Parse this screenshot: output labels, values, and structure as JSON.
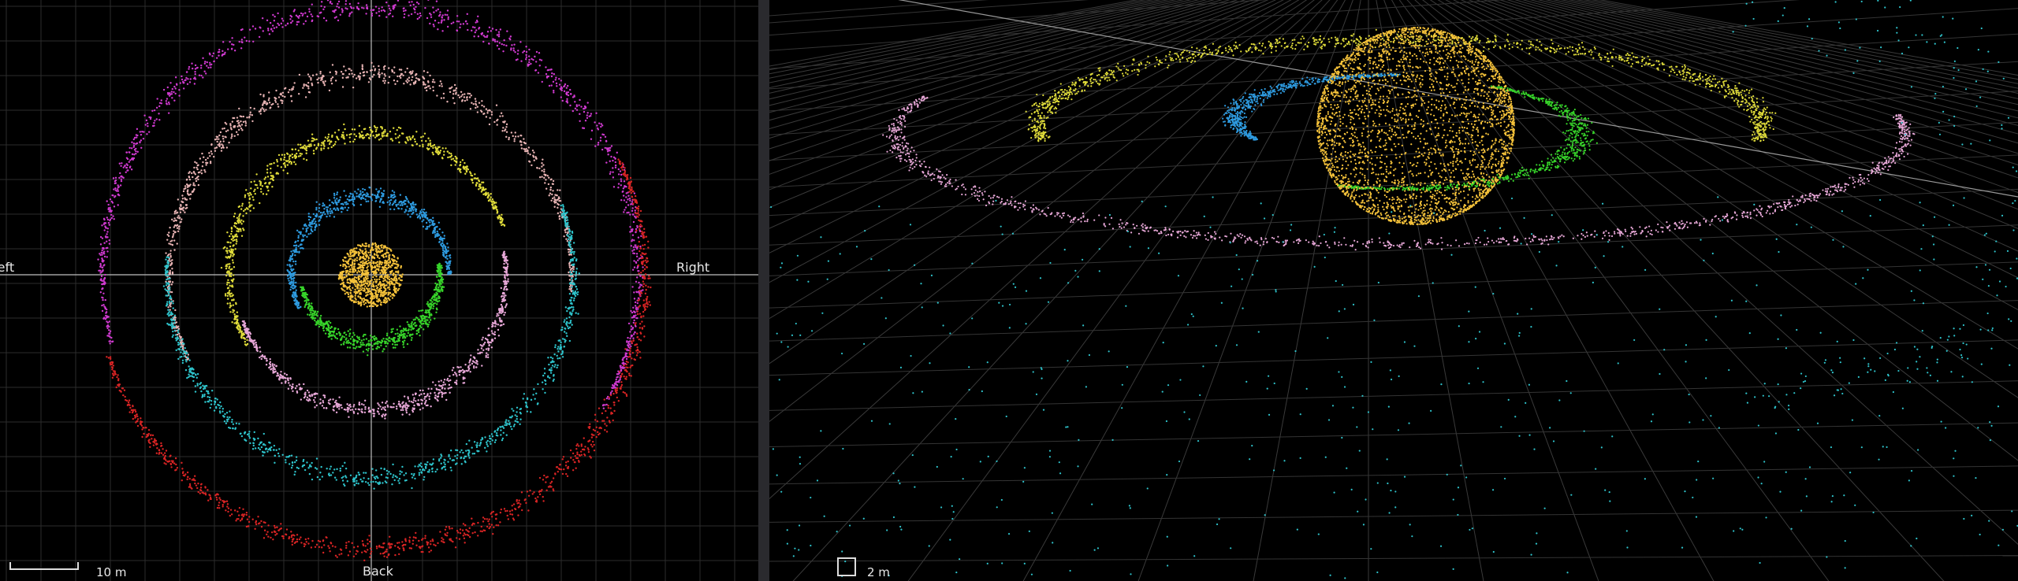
{
  "top_view": {
    "labels": {
      "left": "Left",
      "right": "Right",
      "back": "Back"
    },
    "scale": {
      "label": "10 m"
    }
  },
  "perspective_view": {
    "scale": {
      "label": "2 m"
    }
  },
  "colors": {
    "background": "#000000",
    "splitter": "#2a2a2e",
    "grid": "#2c2c2c",
    "axis": "#bfbfbf",
    "sun": "#f5c23a",
    "ring_blue": "#2e9be0",
    "ring_green": "#37d42a",
    "ring_yellow": "#e0dc3a",
    "ring_pink": "#e8a8d8",
    "ring_peach": "#e8b4b4",
    "ring_cyan": "#2ec4cc",
    "ring_magenta": "#d03ad0",
    "ring_red": "#d82424"
  }
}
